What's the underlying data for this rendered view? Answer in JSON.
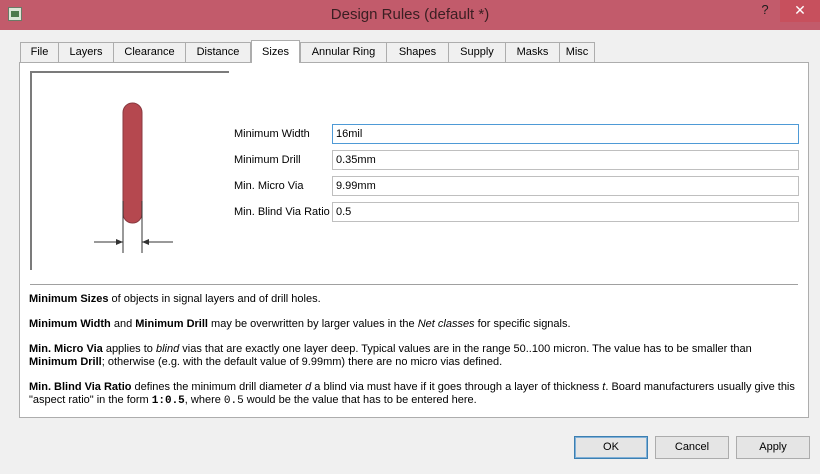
{
  "window": {
    "title": "Design Rules (default *)",
    "help_label": "?",
    "close_label": "✕"
  },
  "tabs": [
    {
      "label": "File"
    },
    {
      "label": "Layers"
    },
    {
      "label": "Clearance"
    },
    {
      "label": "Distance"
    },
    {
      "label": "Sizes",
      "active": true
    },
    {
      "label": "Annular Ring"
    },
    {
      "label": "Shapes"
    },
    {
      "label": "Supply"
    },
    {
      "label": "Masks"
    },
    {
      "label": "Misc"
    }
  ],
  "form": {
    "min_width": {
      "label": "Minimum Width",
      "value": "16mil"
    },
    "min_drill": {
      "label": "Minimum Drill",
      "value": "0.35mm"
    },
    "min_micro_via": {
      "label": "Min. Micro Via",
      "value": "9.99mm"
    },
    "min_blind_via_ratio": {
      "label": "Min. Blind Via Ratio",
      "value": "0.5"
    }
  },
  "description": {
    "p1": {
      "b1": "Minimum Sizes",
      "t1": " of objects in signal layers and of drill holes."
    },
    "p2": {
      "b1": "Minimum Width",
      "t1": " and ",
      "b2": "Minimum Drill",
      "t2": " may be overwritten by larger values in the ",
      "i1": "Net classes",
      "t3": " for specific signals."
    },
    "p3": {
      "b1": "Min. Micro Via",
      "t1": " applies to ",
      "i1": "blind",
      "t2": " vias that are exactly one layer deep. Typical values are in the range 50..100 micron. The value has to be smaller than ",
      "b2": "Minimum Drill",
      "t3": "; otherwise (e.g. with the default value of 9.99mm) there are no micro vias defined."
    },
    "p4": {
      "b1": "Min. Blind Via Ratio",
      "t1": " defines the minimum drill diameter ",
      "i1": "d",
      "t2": " a blind via must have if it goes through a layer of thickness ",
      "i2": "t",
      "t3": ". Board manufacturers usually give this \"aspect ratio\" in the form ",
      "m1": "1:0.5",
      "t4": ", where ",
      "m2": "0.5",
      "t5": " would be the value that has to be entered here."
    }
  },
  "buttons": {
    "ok": "OK",
    "cancel": "Cancel",
    "apply": "Apply"
  },
  "colors": {
    "titlebar": "#c25b6b",
    "trace": "#b5484f",
    "focus_border": "#4e9ad6"
  }
}
